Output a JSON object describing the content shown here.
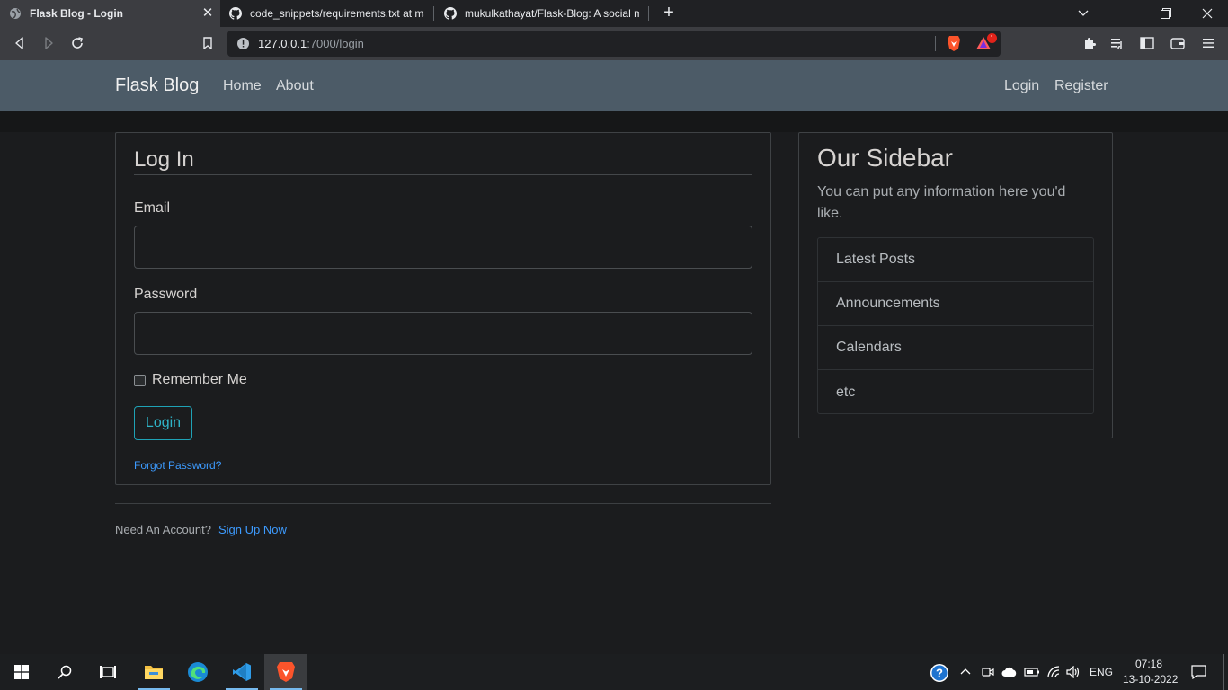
{
  "browser": {
    "tabs": [
      {
        "label": "Flask Blog - Login",
        "icon": "globe-icon",
        "active": true
      },
      {
        "label": "code_snippets/requirements.txt at ma",
        "icon": "github-icon",
        "active": false
      },
      {
        "label": "mukulkathayat/Flask-Blog: A social me",
        "icon": "github-icon",
        "active": false
      }
    ],
    "url_host": "127.0.0.1",
    "url_path": ":7000/login",
    "shield_badge": "1"
  },
  "navbar": {
    "brand": "Flask Blog",
    "links": [
      "Home",
      "About"
    ],
    "right_links": [
      "Login",
      "Register"
    ]
  },
  "login": {
    "title": "Log In",
    "email_label": "Email",
    "email_value": "",
    "password_label": "Password",
    "password_value": "",
    "remember_label": "Remember Me",
    "submit_label": "Login",
    "forgot_label": "Forgot Password?"
  },
  "account": {
    "prompt": "Need An Account?",
    "signup_label": "Sign Up Now"
  },
  "sidebar": {
    "title": "Our Sidebar",
    "text": "You can put any information here you'd like.",
    "items": [
      "Latest Posts",
      "Announcements",
      "Calendars",
      "etc"
    ]
  },
  "taskbar": {
    "language": "ENG",
    "time": "07:18",
    "date": "13-10-2022"
  },
  "colors": {
    "navbar_bg": "#4c5b67",
    "page_bg": "#1b1c1e",
    "link": "#3d9bff",
    "login_button": "#1fa2b6"
  }
}
